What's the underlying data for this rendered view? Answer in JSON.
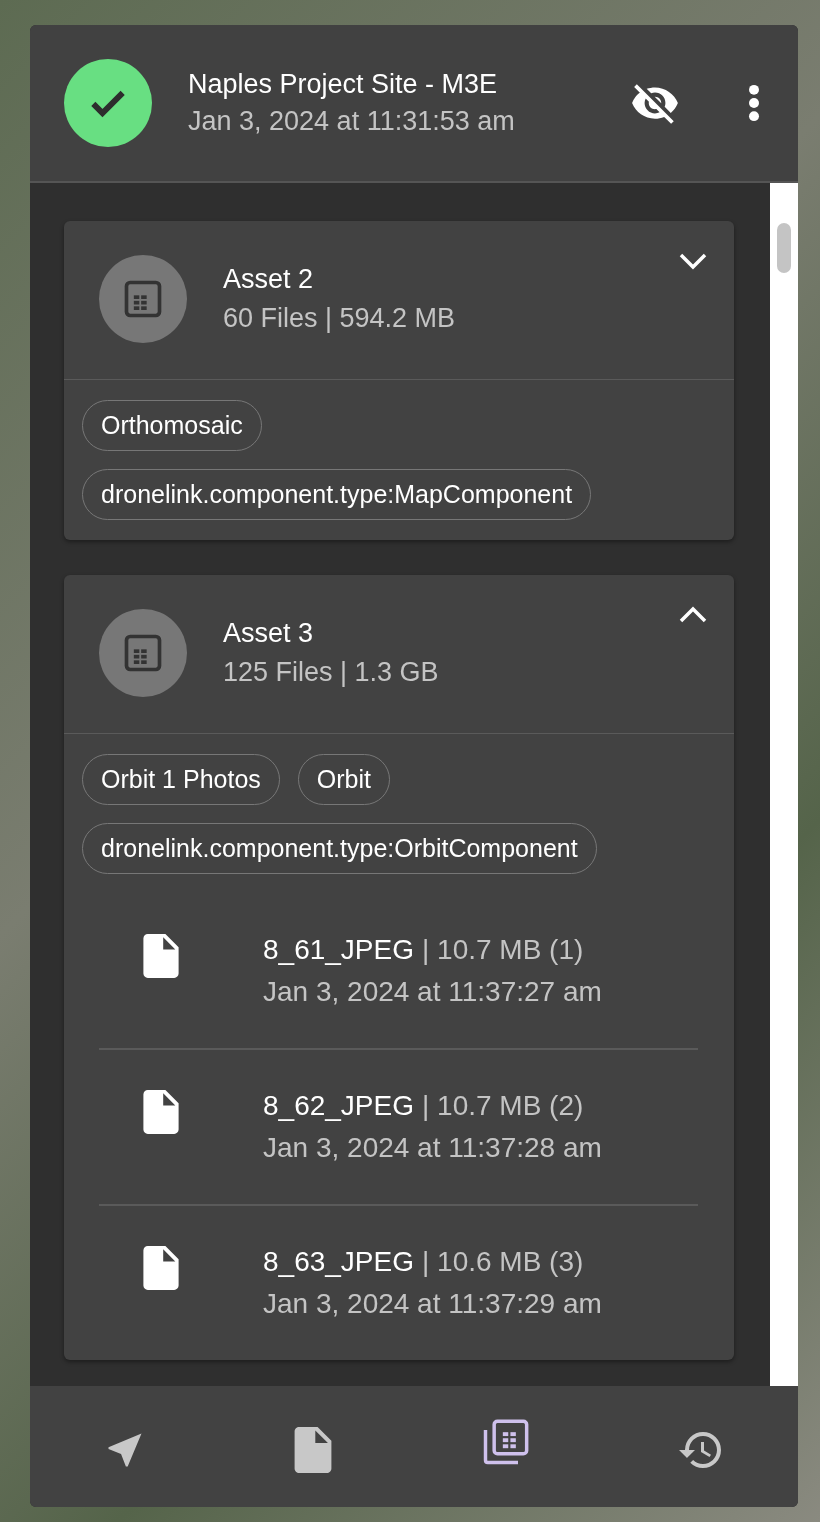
{
  "header": {
    "title": "Naples Project Site - M3E",
    "subtitle": "Jan 3, 2024 at 11:31:53 am",
    "completed": true,
    "hidden": true
  },
  "assets": [
    {
      "name": "Asset 2",
      "summary": "60 Files | 594.2 MB",
      "expanded": false,
      "tags": [
        "Orthomosaic",
        "dronelink.component.type:MapComponent"
      ]
    },
    {
      "name": "Asset 3",
      "summary": "125 Files | 1.3 GB",
      "expanded": true,
      "tags": [
        "Orbit 1 Photos",
        "Orbit",
        "dronelink.component.type:OrbitComponent"
      ],
      "files": [
        {
          "name": "8_61_JPEG",
          "size": "| 10.7 MB (1)",
          "time": "Jan 3, 2024 at 11:37:27 am"
        },
        {
          "name": "8_62_JPEG",
          "size": "| 10.7 MB (2)",
          "time": "Jan 3, 2024 at 11:37:28 am"
        },
        {
          "name": "8_63_JPEG",
          "size": "| 10.6 MB (3)",
          "time": "Jan 3, 2024 at 11:37:29 am"
        }
      ]
    }
  ],
  "nav": [
    {
      "kind": "navigate",
      "selected": false
    },
    {
      "kind": "file",
      "selected": false
    },
    {
      "kind": "assets",
      "selected": true
    },
    {
      "kind": "history",
      "selected": false
    }
  ]
}
